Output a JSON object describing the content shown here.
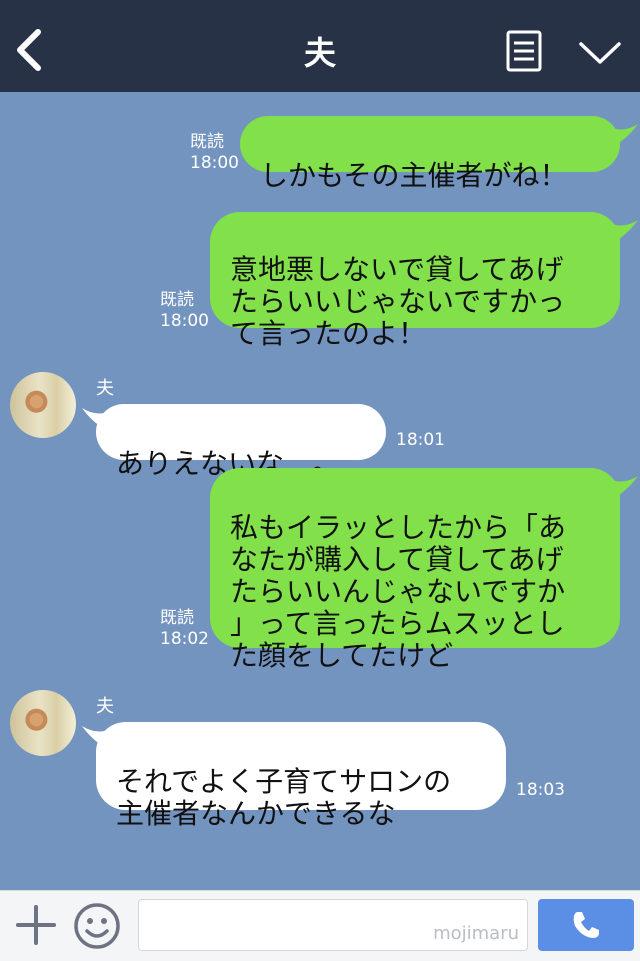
{
  "header": {
    "title": "夫"
  },
  "messages": [
    {
      "side": "out",
      "text": "しかもその主催者がね！",
      "read": "既読",
      "time": "18:00"
    },
    {
      "side": "out",
      "text": "意地悪しないで貸してあげ\nたらいいじゃないですかっ\nて言ったのよ！",
      "read": "既読",
      "time": "18:00"
    },
    {
      "side": "in",
      "sender": "夫",
      "text": "ありえないな…。",
      "time": "18:01"
    },
    {
      "side": "out",
      "text": "私もイラッとしたから「あ\nなたが購入して貸してあげ\nたらいいんじゃないですか\n」って言ったらムスッとし\nた顔をしてたけど",
      "read": "既読",
      "time": "18:02"
    },
    {
      "side": "in",
      "sender": "夫",
      "text": "それでよく子育てサロンの\n主催者なんかできるな",
      "time": "18:03"
    }
  ],
  "footer": {
    "watermark": "mojimaru"
  },
  "colors": {
    "header_bg": "#273246",
    "chat_bg": "#7494c0",
    "outgoing_bubble": "#82e04a",
    "incoming_bubble": "#ffffff",
    "call_button": "#5b8fe6"
  },
  "icons": [
    "back-chevron-icon",
    "notes-icon",
    "chevron-down-icon",
    "plus-icon",
    "emoji-icon",
    "phone-icon"
  ]
}
